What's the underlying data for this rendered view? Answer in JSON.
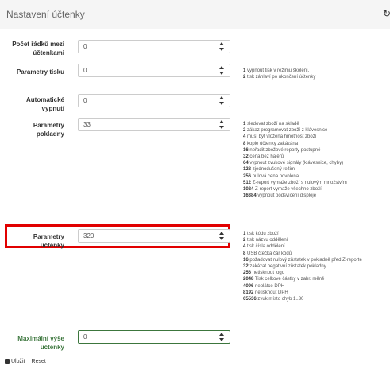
{
  "header": {
    "title": "Nastavení účtenky"
  },
  "fields": [
    {
      "label": "Počet řádků mezi účtenkami",
      "value": "0"
    },
    {
      "label": "Parametry tisku",
      "value": "0",
      "help": [
        {
          "code": "1",
          "text": "vypnout tisk v režimu školení,"
        },
        {
          "code": "2",
          "text": "tisk záhlaví po ukončení účtenky"
        }
      ]
    },
    {
      "label": "Automatické vypnutí",
      "value": "0"
    },
    {
      "label": "Parametry pokladny",
      "value": "33",
      "help": [
        {
          "code": "1",
          "text": "sledovat zboží na skladě"
        },
        {
          "code": "2",
          "text": "zákaz programovat zboží z klávesnice"
        },
        {
          "code": "4",
          "text": "musí být vložena hmotnost zboží"
        },
        {
          "code": "8",
          "text": "kopie účtenky zakázána"
        },
        {
          "code": "16",
          "text": "neřadit zbožové reporty postupně"
        },
        {
          "code": "32",
          "text": "cena bez haléřů"
        },
        {
          "code": "64",
          "text": "vypnout zvukové signály (klávesnice, chyby)"
        },
        {
          "code": "128",
          "text": "zjednodušený režim"
        },
        {
          "code": "256",
          "text": "nulová cena povolena"
        },
        {
          "code": "512",
          "text": "Z-report vymaže zboží s nulovým množstvím"
        },
        {
          "code": "1024",
          "text": "Z-report vymaže všechno zboží"
        },
        {
          "code": "16384",
          "text": "vypnout podsvícení displeje"
        }
      ]
    },
    {
      "label": "Parametry účtenky",
      "value": "320",
      "help": [
        {
          "code": "1",
          "text": "tisk kódu zboží"
        },
        {
          "code": "2",
          "text": "tisk názvu oddělení"
        },
        {
          "code": "4",
          "text": "tisk čísla oddělení"
        },
        {
          "code": "8",
          "text": "USB čtečka čár kódů"
        },
        {
          "code": "16",
          "text": "požadovat nulový zůstatek v pokladně před Z-reporte"
        },
        {
          "code": "32",
          "text": "zakázat negativní zůstatek pokladny"
        },
        {
          "code": "256",
          "text": "netisknout logo"
        },
        {
          "code": "2048",
          "text": "Tisk celkové částky v zahr. měně"
        },
        {
          "code": "4096",
          "text": "neplátce DPH"
        },
        {
          "code": "8192",
          "text": "netisknout DPH"
        },
        {
          "code": "65536",
          "text": "zvuk místo chyb 1..30"
        }
      ]
    },
    {
      "label": "Maximální výše účtenky",
      "value": "0"
    }
  ],
  "buttons": {
    "save": "Uložit",
    "reset": "Reset"
  },
  "icons": {
    "refresh": "refresh-icon",
    "save": "floppy-disk-icon",
    "spinner": "spinner-arrows-icon"
  },
  "colors": {
    "highlight": "#e10000",
    "valid": "#3c763d"
  }
}
